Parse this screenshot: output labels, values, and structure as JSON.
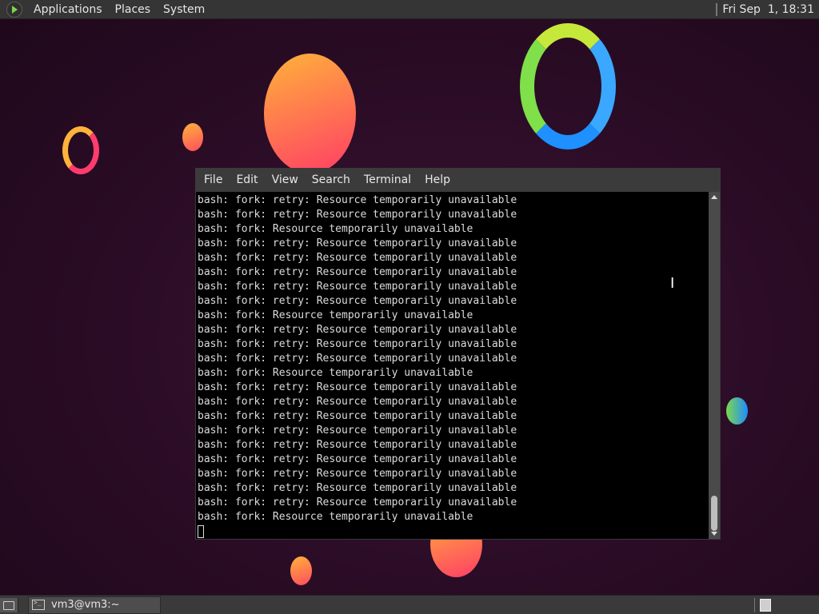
{
  "top_panel": {
    "menus": [
      "Applications",
      "Places",
      "System"
    ],
    "clock": "Fri Sep  1, 18:31"
  },
  "terminal": {
    "menus": [
      "File",
      "Edit",
      "View",
      "Search",
      "Terminal",
      "Help"
    ],
    "lines": [
      "bash: fork: retry: Resource temporarily unavailable",
      "bash: fork: retry: Resource temporarily unavailable",
      "bash: fork: Resource temporarily unavailable",
      "bash: fork: retry: Resource temporarily unavailable",
      "bash: fork: retry: Resource temporarily unavailable",
      "bash: fork: retry: Resource temporarily unavailable",
      "bash: fork: retry: Resource temporarily unavailable",
      "bash: fork: retry: Resource temporarily unavailable",
      "bash: fork: Resource temporarily unavailable",
      "bash: fork: retry: Resource temporarily unavailable",
      "bash: fork: retry: Resource temporarily unavailable",
      "bash: fork: retry: Resource temporarily unavailable",
      "bash: fork: Resource temporarily unavailable",
      "bash: fork: retry: Resource temporarily unavailable",
      "bash: fork: retry: Resource temporarily unavailable",
      "bash: fork: retry: Resource temporarily unavailable",
      "bash: fork: retry: Resource temporarily unavailable",
      "bash: fork: retry: Resource temporarily unavailable",
      "bash: fork: retry: Resource temporarily unavailable",
      "bash: fork: retry: Resource temporarily unavailable",
      "bash: fork: retry: Resource temporarily unavailable",
      "bash: fork: retry: Resource temporarily unavailable",
      "bash: fork: Resource temporarily unavailable"
    ]
  },
  "taskbar": {
    "window_title": "vm3@vm3:~"
  },
  "colors": {
    "desktop_bg": "#2a0c25",
    "panel_bg": "#353535",
    "terminal_bg": "#000000",
    "terminal_fg": "#dcdcdc"
  }
}
